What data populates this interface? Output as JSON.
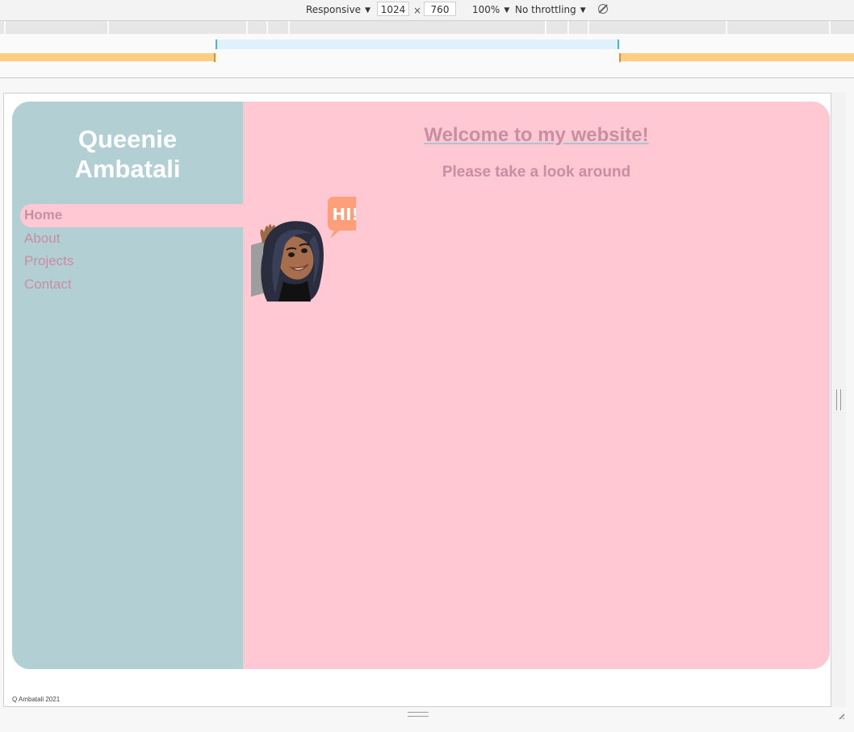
{
  "devtools": {
    "device_label": "Responsive",
    "width_value": "1024",
    "times": "×",
    "height_value": "760",
    "zoom_label": "100%",
    "throttle_label": "No throttling"
  },
  "site": {
    "name_line1": "Queenie",
    "name_line2": "Ambatali",
    "nav": [
      {
        "label": "Home"
      },
      {
        "label": "About"
      },
      {
        "label": "Projects"
      },
      {
        "label": "Contact"
      }
    ],
    "heading": "Welcome to my website!",
    "subheading": "Please take a look around",
    "bubble_text": "HI!",
    "footer": "Q Ambatali 2021"
  },
  "colors": {
    "sidebar": "#b2d0d4",
    "content": "#ffc8d3",
    "accent_text": "#c88ea1",
    "bubble": "#ff9f7a"
  },
  "icons": [
    "chevron-down-icon",
    "rotate-icon",
    "resize-handle-icon"
  ]
}
